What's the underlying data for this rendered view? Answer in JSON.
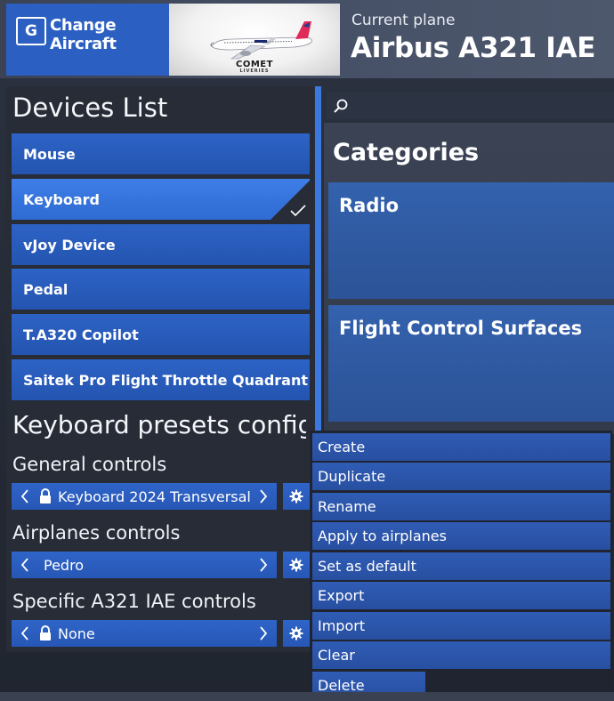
{
  "header": {
    "change_key": "G",
    "change_label": "Change Aircraft",
    "thumb_brand": "COMET",
    "thumb_sub": "LIVERIES",
    "current_plane_label": "Current plane",
    "current_plane_name": "Airbus A321 IAE"
  },
  "devices": {
    "title": "Devices List",
    "items": [
      {
        "label": "Mouse",
        "selected": false
      },
      {
        "label": "Keyboard",
        "selected": true
      },
      {
        "label": "vJoy Device",
        "selected": false
      },
      {
        "label": "Pedal",
        "selected": false
      },
      {
        "label": "T.A320 Copilot",
        "selected": false
      },
      {
        "label": "Saitek Pro Flight Throttle Quadrant",
        "selected": false
      }
    ]
  },
  "presets": {
    "title": "Keyboard presets config",
    "general": {
      "label": "General controls",
      "value": "Keyboard 2024 Transversal",
      "locked": true
    },
    "airplanes": {
      "label": "Airplanes controls",
      "value": "Pedro",
      "locked": false
    },
    "specific": {
      "label": "Specific A321 IAE controls",
      "value": "None",
      "locked": true
    }
  },
  "search": {
    "placeholder": ""
  },
  "categories": {
    "title": "Categories",
    "items": [
      "Radio",
      "Flight Control Surfaces"
    ]
  },
  "context_menu": {
    "items": [
      "Create",
      "Duplicate",
      "Rename",
      "Apply to airplanes",
      "Set as default",
      "Export",
      "Import",
      "Clear",
      "Delete"
    ]
  },
  "colors": {
    "accent": "#2d63c6",
    "accent_selected": "#3d7ee6",
    "panel": "#272c36"
  }
}
